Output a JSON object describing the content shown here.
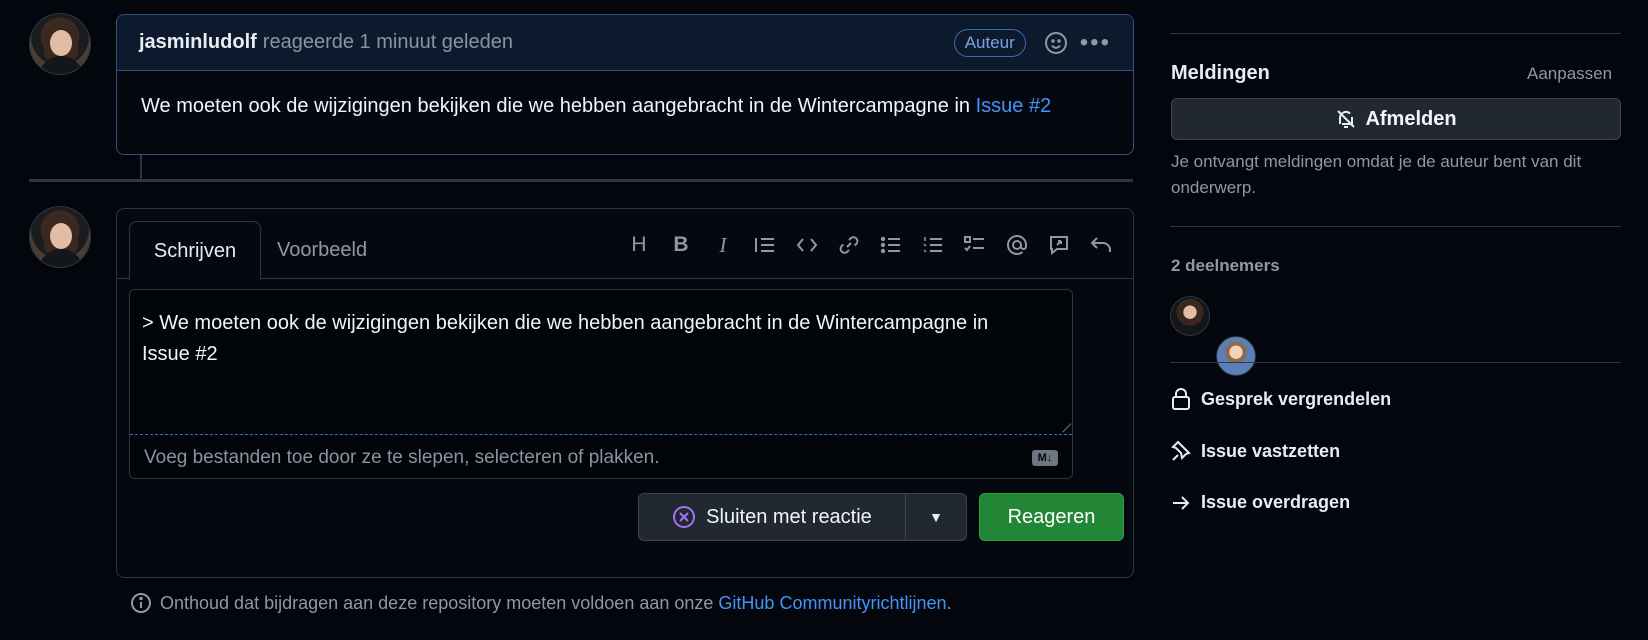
{
  "comment": {
    "author": "jasminludolf",
    "meta": "reageerde 1 minuut geleden",
    "badge": "Auteur",
    "body_prefix": "We moeten ook de wijzigingen bekijken die we hebben aangebracht in de Wintercampagne in",
    "body_link": "Issue #2"
  },
  "editor": {
    "tab_write": "Schrijven",
    "tab_preview": "Voorbeeld",
    "toolbar_icons": [
      "heading-icon",
      "bold-icon",
      "italic-icon",
      "quote-icon",
      "code-icon",
      "link-icon",
      "unordered-list-icon",
      "ordered-list-icon",
      "task-list-icon",
      "mention-icon",
      "reference-icon",
      "undo-icon"
    ],
    "text_line1": "> We moeten ook de wijzigingen bekijken die we hebben aangebracht in de Wintercampagne in",
    "text_line2": "Issue #2",
    "attach_hint": "Voeg bestanden toe door ze te slepen, selecteren of plakken.",
    "md_badge": "M↓"
  },
  "actions": {
    "close_label": "Sluiten met reactie",
    "submit_label": "Reageren"
  },
  "guidelines": {
    "prefix": "Onthoud dat bijdragen aan deze repository moeten voldoen aan onze",
    "link": "GitHub Communityrichtlijnen",
    "suffix": "."
  },
  "sidebar": {
    "notifications_title": "Meldingen",
    "customize_label": "Aanpassen",
    "unsubscribe_label": "Afmelden",
    "notifications_reason": "Je ontvangt meldingen omdat je de auteur bent van dit onderwerp.",
    "participants_title": "2 deelnemers",
    "lock_label": "Gesprek vergrendelen",
    "pin_label": "Issue vastzetten",
    "transfer_label": "Issue overdragen"
  },
  "colors": {
    "accent_link": "#4493f8",
    "submit_green": "#238636",
    "comment_border": "#2f4f86"
  }
}
